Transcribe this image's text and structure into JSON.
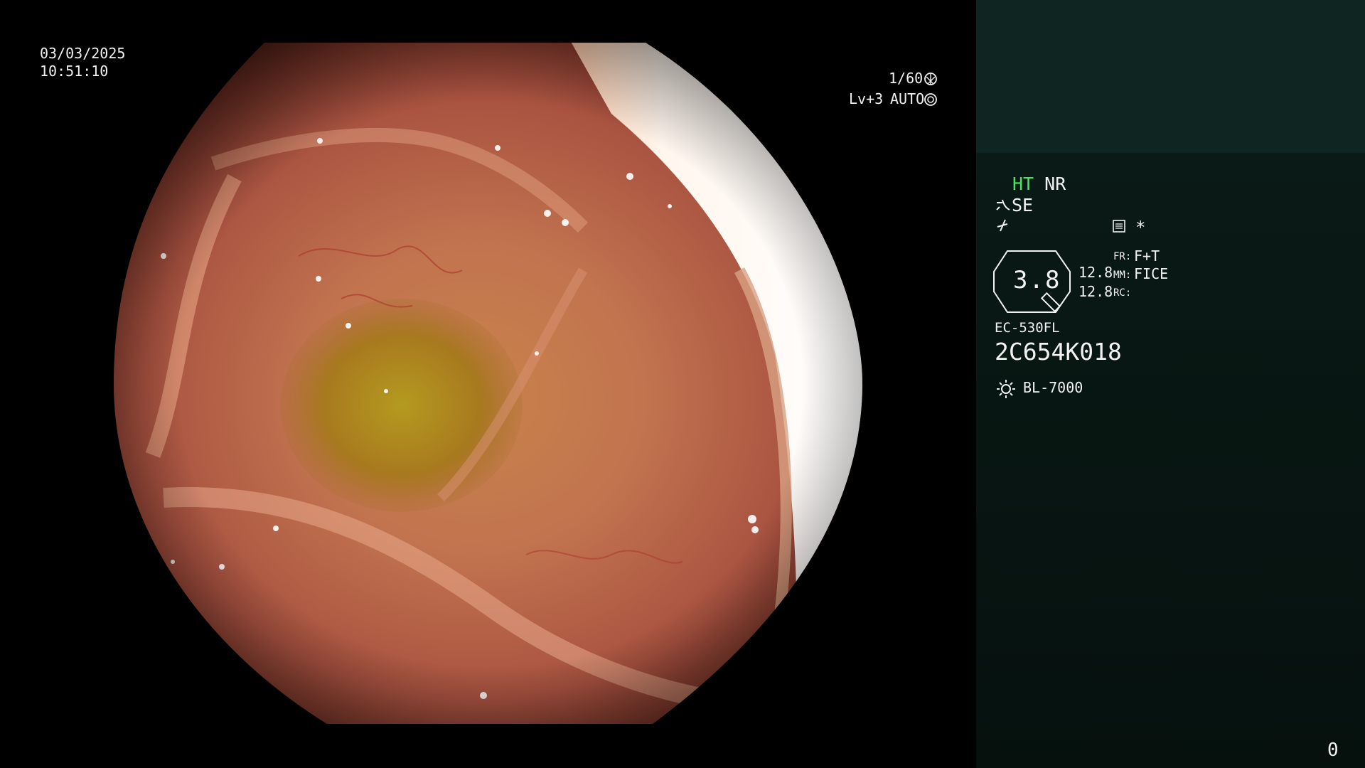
{
  "overlay": {
    "date": "03/03/2025",
    "time": "10:51:10",
    "shutter": "1/60",
    "level": "Lv+3",
    "iris": "AUTO"
  },
  "panel": {
    "mode_ht": "HT",
    "mode_nr": "NR",
    "enhance": "SE",
    "zoom_value": "3.8",
    "val1": "12.8",
    "val2": "12.8",
    "fr_label": "FR:",
    "fr_value": "F+T",
    "mm_label": "MM:",
    "mm_value": "FICE",
    "rc_label": "RC:",
    "scope_model": "EC-530FL",
    "serial": "2C654K018",
    "light_source": "BL-7000",
    "asterisk": "*",
    "counter": "0"
  },
  "icons": {
    "shutter": "aperture-icon",
    "iris": "iris-icon",
    "enhance": "curve-icon",
    "edge": "edge-icon",
    "memo": "memo-icon",
    "light": "sun-icon"
  }
}
